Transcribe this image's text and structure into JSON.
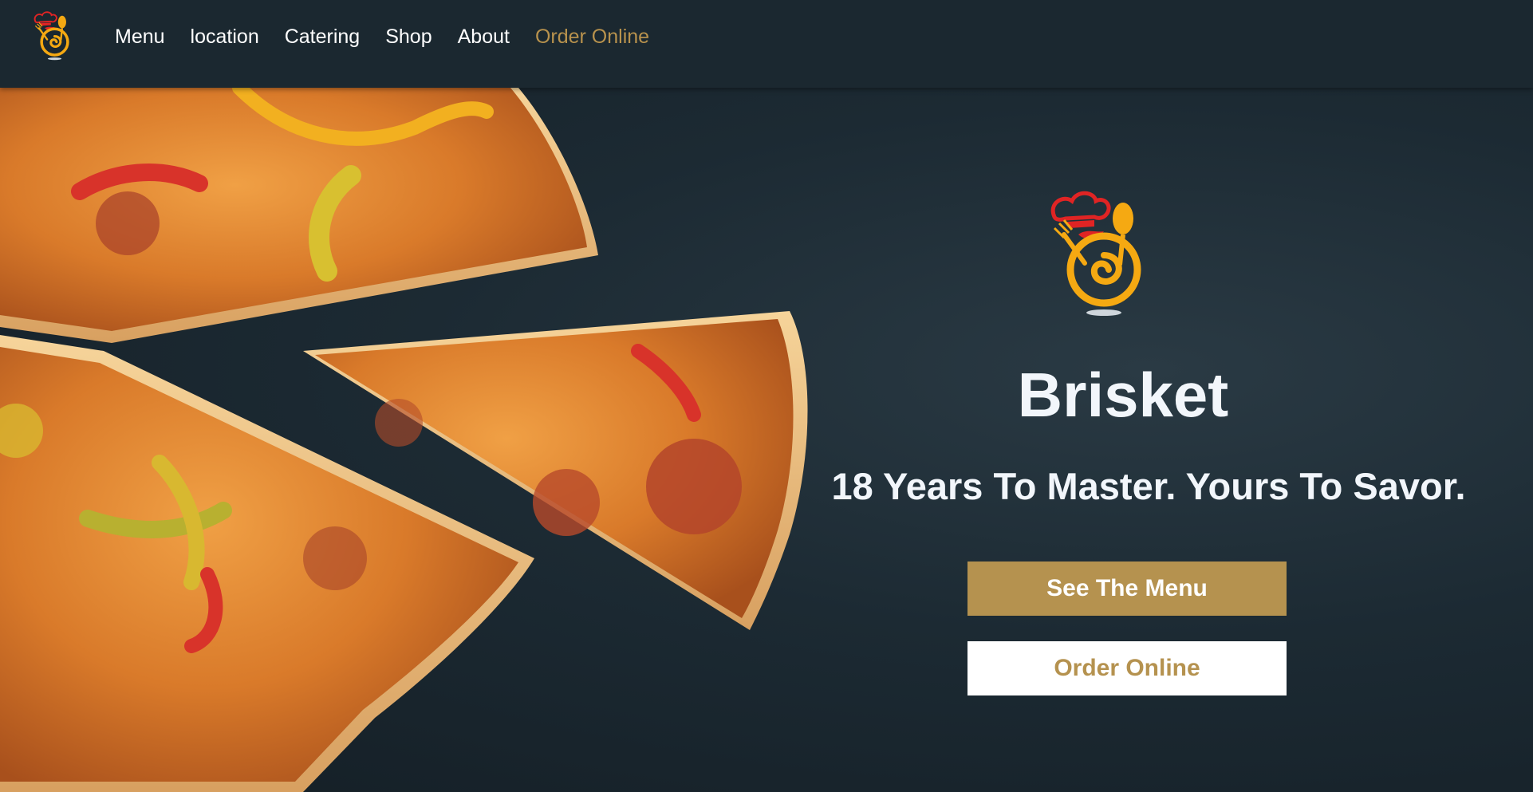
{
  "nav": {
    "items": [
      {
        "label": "Menu"
      },
      {
        "label": "location"
      },
      {
        "label": "Catering"
      },
      {
        "label": "Shop"
      },
      {
        "label": "About"
      },
      {
        "label": "Order Online"
      }
    ],
    "logo_icon": "chef-spoon-fork-logo-icon"
  },
  "hero": {
    "title": "Brisket",
    "tagline": "18 Years To Master. Yours To Savor.",
    "menu_button": "See The Menu",
    "order_button": "Order Online",
    "logo_icon": "chef-spoon-fork-logo-icon"
  },
  "colors": {
    "background": "#1b2830",
    "accent": "#b5924f",
    "text": "#f2f6fb",
    "logo_red": "#e02424",
    "logo_yellow": "#f5a912"
  }
}
